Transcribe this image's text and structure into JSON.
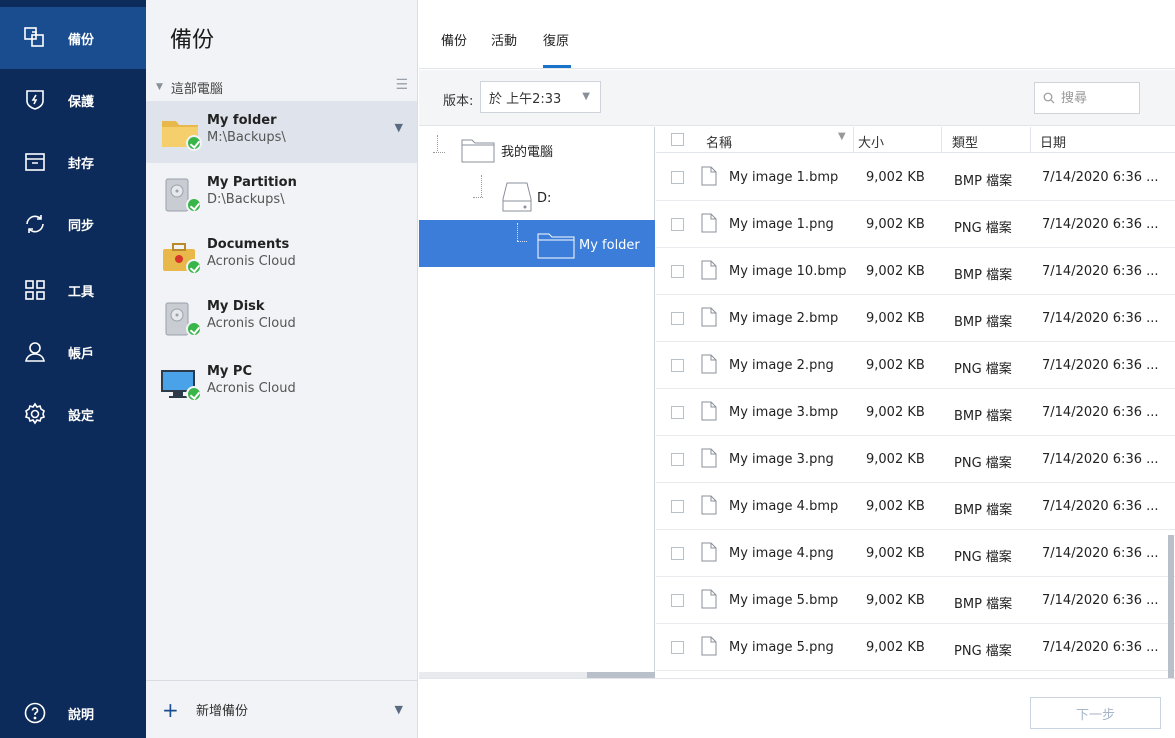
{
  "nav": {
    "items": [
      {
        "label": "備份",
        "icon": "backup-icon"
      },
      {
        "label": "保護",
        "icon": "shield-icon"
      },
      {
        "label": "封存",
        "icon": "archive-icon"
      },
      {
        "label": "同步",
        "icon": "sync-icon"
      },
      {
        "label": "工具",
        "icon": "tools-icon"
      },
      {
        "label": "帳戶",
        "icon": "account-icon"
      },
      {
        "label": "設定",
        "icon": "gear-icon"
      }
    ],
    "help_label": "說明"
  },
  "backups": {
    "title": "備份",
    "section": "這部電腦",
    "items": [
      {
        "name": "My folder",
        "location": "M:\\Backups\\"
      },
      {
        "name": "My Partition",
        "location": "D:\\Backups\\"
      },
      {
        "name": "Documents",
        "location": "Acronis Cloud"
      },
      {
        "name": "My Disk",
        "location": "Acronis Cloud"
      },
      {
        "name": "My PC",
        "location": "Acronis Cloud"
      }
    ],
    "add_label": "新增備份"
  },
  "tabs": [
    "備份",
    "活動",
    "復原"
  ],
  "toolbar": {
    "version_label": "版本:",
    "version_value": "於 上午2:33",
    "search_placeholder": "搜尋"
  },
  "tree": {
    "root": "我的電腦",
    "drive": "D:",
    "folder": "My folder"
  },
  "files": {
    "columns": [
      "名稱",
      "大小",
      "類型",
      "日期"
    ],
    "rows": [
      {
        "name": "My image 1.bmp",
        "size": "9,002 KB",
        "type": "BMP 檔案",
        "date": "7/14/2020 6:36 ..."
      },
      {
        "name": "My image 1.png",
        "size": "9,002 KB",
        "type": "PNG 檔案",
        "date": "7/14/2020 6:36 ..."
      },
      {
        "name": "My image 10.bmp",
        "size": "9,002 KB",
        "type": "BMP 檔案",
        "date": "7/14/2020 6:36 ..."
      },
      {
        "name": "My image 2.bmp",
        "size": "9,002 KB",
        "type": "BMP 檔案",
        "date": "7/14/2020 6:36 ..."
      },
      {
        "name": "My image 2.png",
        "size": "9,002 KB",
        "type": "PNG 檔案",
        "date": "7/14/2020 6:36 ..."
      },
      {
        "name": "My image 3.bmp",
        "size": "9,002 KB",
        "type": "BMP 檔案",
        "date": "7/14/2020 6:36 ..."
      },
      {
        "name": "My image 3.png",
        "size": "9,002 KB",
        "type": "PNG 檔案",
        "date": "7/14/2020 6:36 ..."
      },
      {
        "name": "My image 4.bmp",
        "size": "9,002 KB",
        "type": "BMP 檔案",
        "date": "7/14/2020 6:36 ..."
      },
      {
        "name": "My image 4.png",
        "size": "9,002 KB",
        "type": "PNG 檔案",
        "date": "7/14/2020 6:36 ..."
      },
      {
        "name": "My image 5.bmp",
        "size": "9,002 KB",
        "type": "BMP 檔案",
        "date": "7/14/2020 6:36 ..."
      },
      {
        "name": "My image 5.png",
        "size": "9,002 KB",
        "type": "PNG 檔案",
        "date": "7/14/2020 6:36 ..."
      }
    ]
  },
  "footer": {
    "next_label": "下一步"
  },
  "colors": {
    "nav_bg": "#0c2a5a",
    "nav_active": "#1a4d8f",
    "selection": "#3b7dd8",
    "ok_badge": "#3ab54a"
  }
}
